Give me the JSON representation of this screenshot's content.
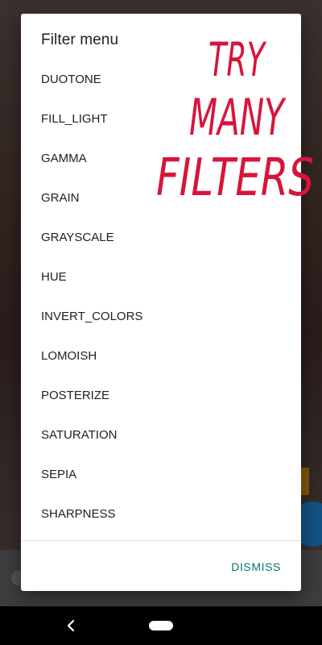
{
  "dialog": {
    "title": "Filter menu",
    "items": [
      "DUOTONE",
      "FILL_LIGHT",
      "GAMMA",
      "GRAIN",
      "GRAYSCALE",
      "HUE",
      "INVERT_COLORS",
      "LOMOISH",
      "POSTERIZE",
      "SATURATION",
      "SEPIA",
      "SHARPNESS"
    ],
    "dismiss_label": "DISMISS"
  },
  "overlay": {
    "lines": [
      "TRY",
      "MANY",
      "FILTERS"
    ],
    "color": "#d8143a"
  },
  "colors": {
    "accent": "#00796b",
    "scrim": "rgba(0,0,0,0.45)"
  },
  "icons": {
    "nav_back": "back-chevron-icon",
    "nav_home": "home-pill-icon",
    "settings": "gear-icon"
  }
}
